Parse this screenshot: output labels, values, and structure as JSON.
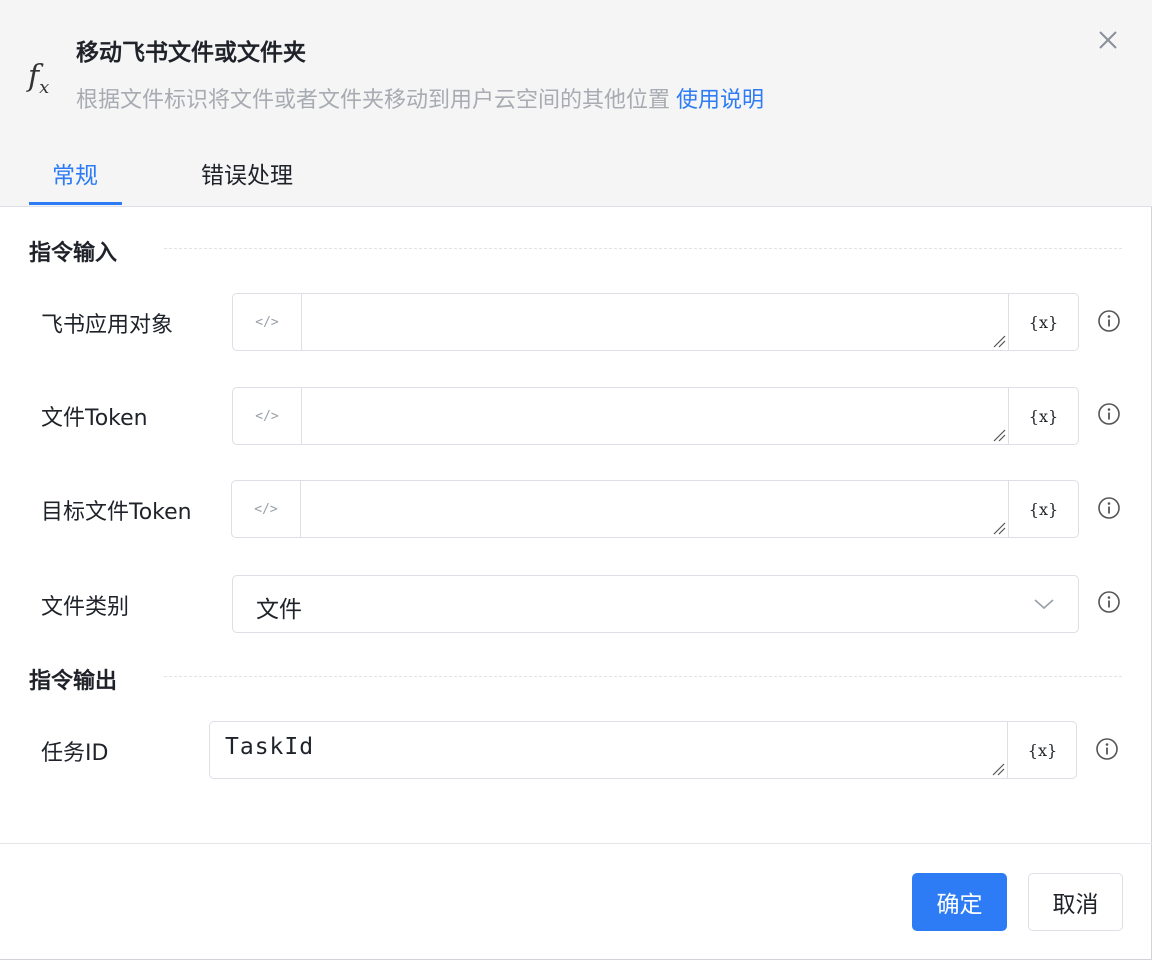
{
  "dialog": {
    "title": "移动飞书文件或文件夹",
    "description": "根据文件标识将文件或者文件夹移动到用户云空间的其他位置",
    "help_link": "使用说明",
    "icon": "fx-icon",
    "close_icon": "close-icon"
  },
  "tabs": [
    {
      "label": "常规",
      "active": true
    },
    {
      "label": "错误处理",
      "active": false
    }
  ],
  "sections": {
    "input_title": "指令输入",
    "output_title": "指令输出"
  },
  "fields": [
    {
      "label": "飞书应用对象",
      "value": "",
      "var_label": "{x}"
    },
    {
      "label": "文件Token",
      "value": "",
      "var_label": "{x}"
    },
    {
      "label": "目标文件Token",
      "value": "",
      "var_label": "{x}"
    }
  ],
  "file_type": {
    "label": "文件类别",
    "selected": "文件"
  },
  "output": {
    "label": "任务ID",
    "value": "TaskId",
    "var_label": "{x}"
  },
  "code_icon_text": "</>",
  "buttons": {
    "ok": "确定",
    "cancel": "取消"
  },
  "colors": {
    "accent": "#2d7cf6",
    "header_bg": "#f5f5f5",
    "muted_text": "#a8abb2"
  }
}
